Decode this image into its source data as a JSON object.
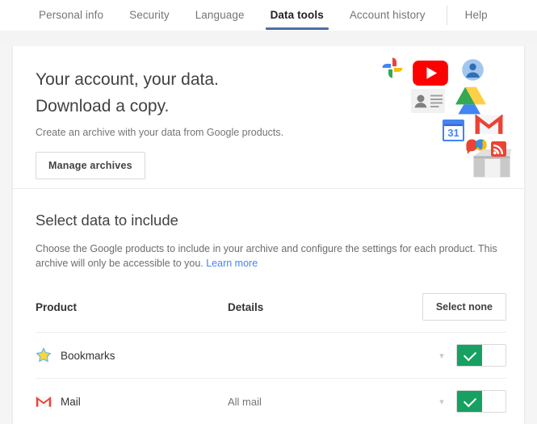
{
  "nav": {
    "tabs": [
      {
        "label": "Personal info",
        "active": false
      },
      {
        "label": "Security",
        "active": false
      },
      {
        "label": "Language",
        "active": false
      },
      {
        "label": "Data tools",
        "active": true
      },
      {
        "label": "Account history",
        "active": false
      },
      {
        "label": "Help",
        "active": false
      }
    ],
    "active_underline_color": "#4a6fa5"
  },
  "hero": {
    "title_line1": "Your account, your data.",
    "title_line2": "Download a copy.",
    "subtitle": "Create an archive with your data from Google products.",
    "button_label": "Manage archives",
    "icons": [
      "google-photos-icon",
      "youtube-icon",
      "profile-avatar-icon",
      "google-contacts-icon",
      "google-drive-icon",
      "google-calendar-icon",
      "gmail-icon",
      "google-hangouts-icon",
      "archive-box-icon"
    ]
  },
  "select_section": {
    "heading": "Select data to include",
    "description_line1": "Choose the Google products to include in your archive and configure the settings for each product.",
    "description_line2": "This archive will only be accessible to you.",
    "learn_more_label": "Learn more",
    "link_color": "#4285f4"
  },
  "table": {
    "headers": {
      "product": "Product",
      "details": "Details"
    },
    "select_none_label": "Select none",
    "rows": [
      {
        "icon": "bookmark-star-icon",
        "product": "Bookmarks",
        "details": "",
        "expand_icon": "chevron-down-icon",
        "toggle_on": true,
        "toggle_color": "#16a163"
      },
      {
        "icon": "gmail-icon",
        "product": "Mail",
        "details": "All mail",
        "expand_icon": "chevron-down-icon",
        "toggle_on": true,
        "toggle_color": "#16a163"
      }
    ]
  }
}
